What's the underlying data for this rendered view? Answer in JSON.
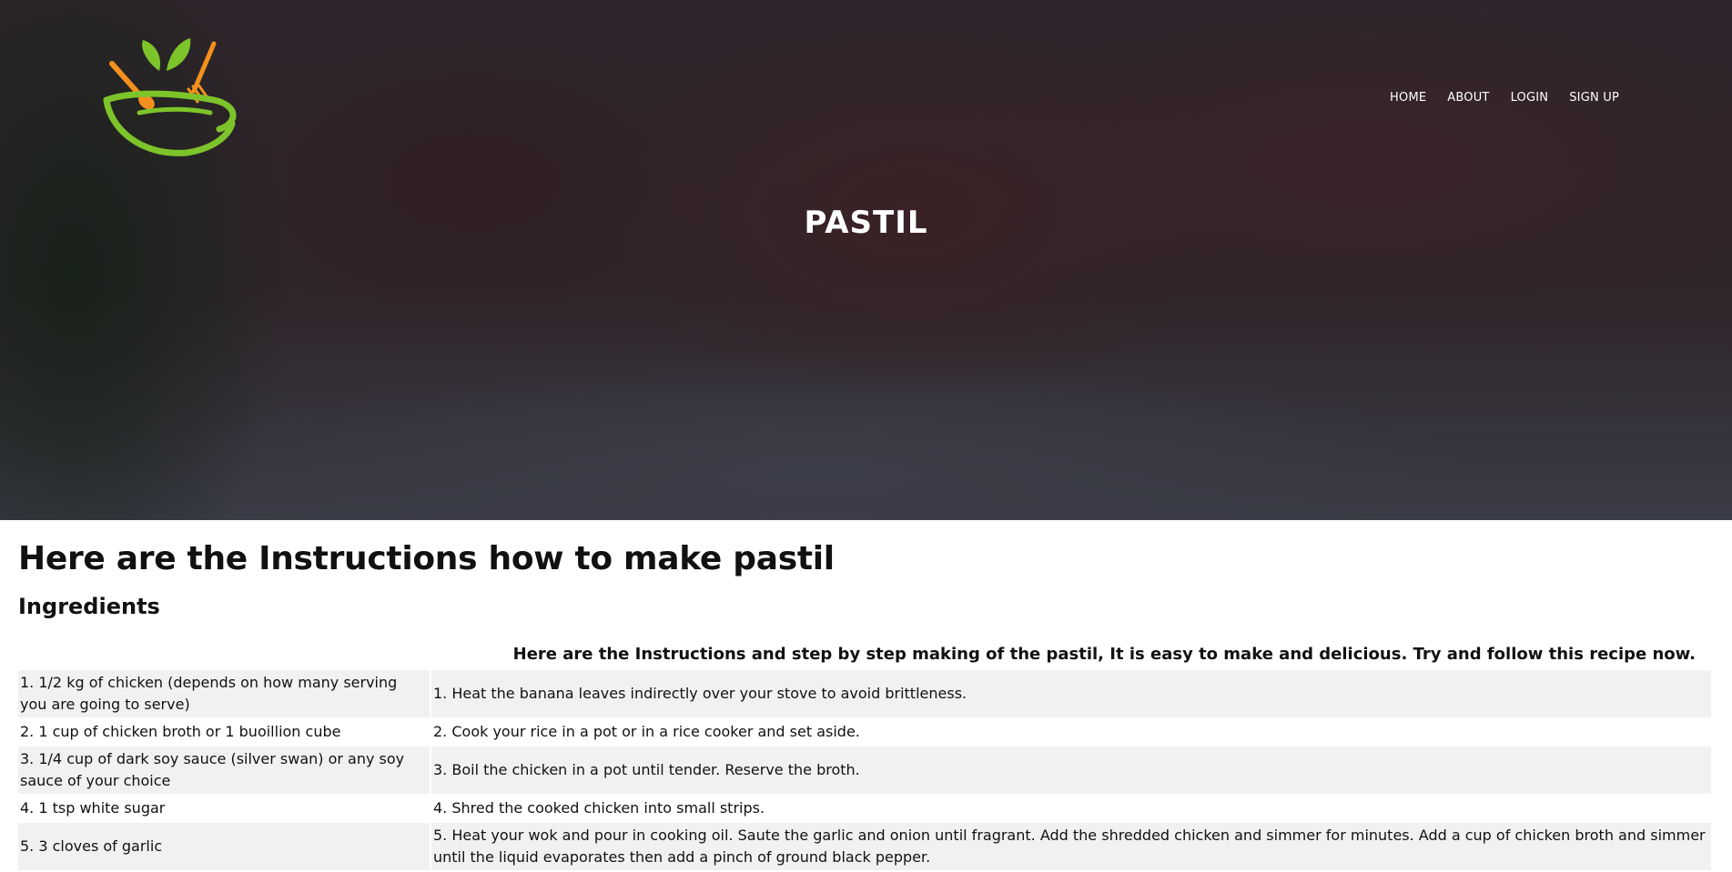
{
  "nav": [
    "HOME",
    "ABOUT",
    "LOGIN",
    "SIGN UP"
  ],
  "hero": {
    "title": "PASTIL"
  },
  "main": {
    "title": "Here are the Instructions how to make pastil",
    "subtitle": "Ingredients",
    "intro": "Here are the Instructions and step by step making of the pastil, It is easy to make and delicious. Try and follow this recipe now."
  },
  "rows": [
    {
      "ingredient": "1. 1/2 kg of chicken (depends on how many serving you are going to serve)",
      "step": "1. Heat the banana leaves indirectly over your stove to avoid brittleness."
    },
    {
      "ingredient": "2. 1 cup of chicken broth or 1 buoillion cube",
      "step": "2. Cook your rice in a pot or in a rice cooker and set aside."
    },
    {
      "ingredient": "3. 1/4 cup of dark soy sauce (silver swan) or any soy sauce of your choice",
      "step": "3. Boil the chicken in a pot until tender. Reserve the broth."
    },
    {
      "ingredient": "4. 1 tsp white sugar",
      "step": "4. Shred the cooked chicken into small strips."
    },
    {
      "ingredient": "5. 3 cloves of garlic",
      "step": "5. Heat your wok and pour in cooking oil. Saute the garlic and onion until fragrant. Add the shredded chicken and simmer for minutes. Add a cup of chicken broth and simmer until the liquid evaporates then add a pinch of ground black pepper."
    }
  ],
  "colors": {
    "leaf_green": "#7dc42a",
    "utensil_orange": "#f5901e",
    "row_shade": "#f1f1f1"
  }
}
